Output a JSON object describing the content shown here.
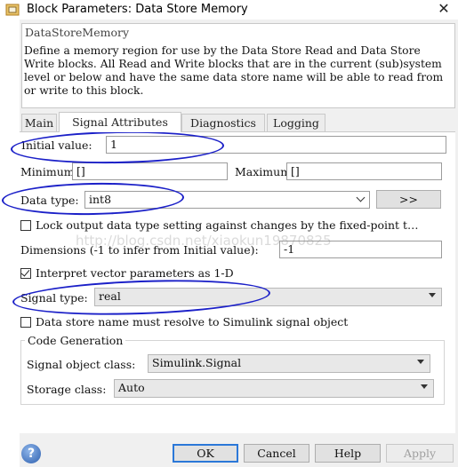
{
  "titlebar": {
    "title": "Block Parameters: Data Store Memory",
    "close_glyph": "✕",
    "icon": "simulink-block-icon"
  },
  "header": {
    "block_name": "DataStoreMemory",
    "description": "Define a memory region for use by the Data Store Read and Data Store Write blocks. All Read and Write blocks that are in the current (sub)system level or below and have the same data store name will be able to read from or write to this block."
  },
  "tabs": [
    {
      "label": "Main"
    },
    {
      "label": "Signal Attributes",
      "active": true
    },
    {
      "label": "Diagnostics"
    },
    {
      "label": "Logging"
    }
  ],
  "signal_attributes": {
    "initial_value_label": "Initial value:",
    "initial_value": "1",
    "minimum_label": "Minimum:",
    "minimum_value": "[]",
    "maximum_label": "Maximum:",
    "maximum_value": "[]",
    "data_type_label": "Data type:",
    "data_type_value": "int8",
    "assistant_button": ">>",
    "lock_label": "Lock output data type setting against changes by the fixed-point t…",
    "lock_checked": false,
    "dimensions_label": "Dimensions (-1 to infer from Initial value):",
    "dimensions_value": "-1",
    "interpret_label": "Interpret vector parameters as 1-D",
    "interpret_checked": true,
    "signal_type_label": "Signal type:",
    "signal_type_value": "real",
    "resolve_label": "Data store name must resolve to Simulink signal object",
    "resolve_checked": false
  },
  "code_generation": {
    "group_title": "Code Generation",
    "signal_object_class_label": "Signal object class:",
    "signal_object_class_value": "Simulink.Signal",
    "storage_class_label": "Storage class:",
    "storage_class_value": "Auto"
  },
  "buttons": {
    "ok": "OK",
    "cancel": "Cancel",
    "help": "Help",
    "apply": "Apply"
  },
  "watermark": "http://blog.csdn.net/xiaokun19870825",
  "colors": {
    "annotation_ink": "#1b20c8",
    "focus_border": "#2b78d8",
    "dialog_bg": "#f0f0f0"
  }
}
